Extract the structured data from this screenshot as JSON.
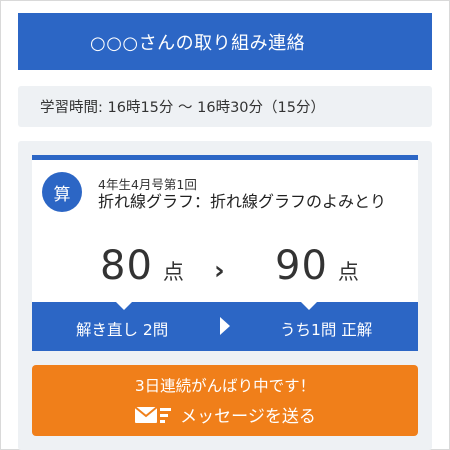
{
  "header": {
    "title": "○○○さんの取り組み連絡"
  },
  "study": {
    "time_text": "学習時間: 16時15分 〜 16時30分（15分）"
  },
  "lesson": {
    "subject_badge": "算",
    "issue": "4年生4月号第1回",
    "unit": "折れ線グラフ：折れ線グラフのよみとり",
    "score_before": "80",
    "score_after": "90",
    "score_unit": "点",
    "arrow": "›",
    "retry_label": "解き直し 2問",
    "correct_label": "うち1問 正解"
  },
  "message": {
    "streak_text": "3日連続がんばり中です！",
    "button_label": "メッセージを送る",
    "icon": "mail-send-icon"
  },
  "colors": {
    "primary": "#2c66c5",
    "accent": "#f07f1a",
    "panel_bg": "#eef1f4"
  }
}
